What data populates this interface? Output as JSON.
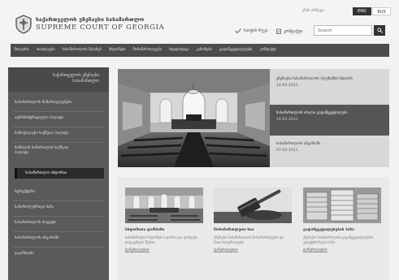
{
  "header": {
    "logo_title_ka": "საქართველოს უზენაესი სასამართლო",
    "logo_title_en": "SUPREME COURT OF GEORGIA",
    "util_label": "ენის არჩევა",
    "lang": {
      "eng": "ENG",
      "rus": "RUS"
    },
    "links": {
      "sitemap": "საიტის რუკა",
      "contact": "კონტაქტი"
    },
    "search_placeholder": "Search"
  },
  "nav": {
    "items": [
      {
        "label": "მთავარი",
        "active": true
      },
      {
        "label": "სიახლეები",
        "active": false
      },
      {
        "label": "სასამართლოს შესახებ",
        "active": false
      },
      {
        "label": "სხდომები",
        "active": false
      },
      {
        "label": "მოსამართლეები",
        "active": false
      },
      {
        "label": "სტატისტიკა",
        "active": false
      },
      {
        "label": "კანონები",
        "active": false
      },
      {
        "label": "გადაწყვეტილებები",
        "active": false
      },
      {
        "label": "კონტაქტი",
        "active": false
      }
    ]
  },
  "sidebar": {
    "title": "საქართველოს უზენაესი სასამართლო",
    "items": [
      "სასამართლოს მიმართულებები",
      "ადმინისტრაციული პალატა",
      "სამოქალაქო საქმეთა პალატა",
      "სისხლის სამართლის საქმეთა პალატა",
      "სასამართლო ისტორია",
      "სტრუქტურა",
      "სამართლებრივი ბაზა",
      "სასამართლოს ბიუჯეტი",
      "სასამართლოს ანგარიში",
      "ვაკანსიები"
    ],
    "active_index": 4
  },
  "news": [
    {
      "title": "უზენაესი სასამართლოს პლენუმის სხდომა",
      "date": "14-03-2011",
      "active": false
    },
    {
      "title": "სასამართლოს ახალი გადაწყვეტილება",
      "date": "14-03-2011",
      "active": true
    },
    {
      "title": "სასამართლოს ანგარიში",
      "date": "07-03-2011",
      "active": false
    }
  ],
  "cards": [
    {
      "title": "სხდომათა დარბაზი",
      "text": "სასამართლო სხდომები საჯაროა და ტარდება დადგენილი წესით.",
      "more": "დაწვრილებით"
    },
    {
      "title": "მოსამართლეთა სია",
      "text": "უზენაესი სასამართლოს მოსამართლეები და მათი ბიოგრაფიები.",
      "more": "დაწვრილებით"
    },
    {
      "title": "გადაწყვეტილებების ბაზა",
      "text": "უზენაესი სასამართლოს გადაწყვეტილებების ელექტრონული ბაზა.",
      "more": "დაწვრილებით"
    }
  ],
  "colors": {
    "nav_bg": "#4c4c4c",
    "sidebar_bg": "#5a5a5a",
    "sidebar_active": "#2b2b2b",
    "news_panel_bg": "#d8d8d8",
    "news_active_bg": "#555555"
  }
}
